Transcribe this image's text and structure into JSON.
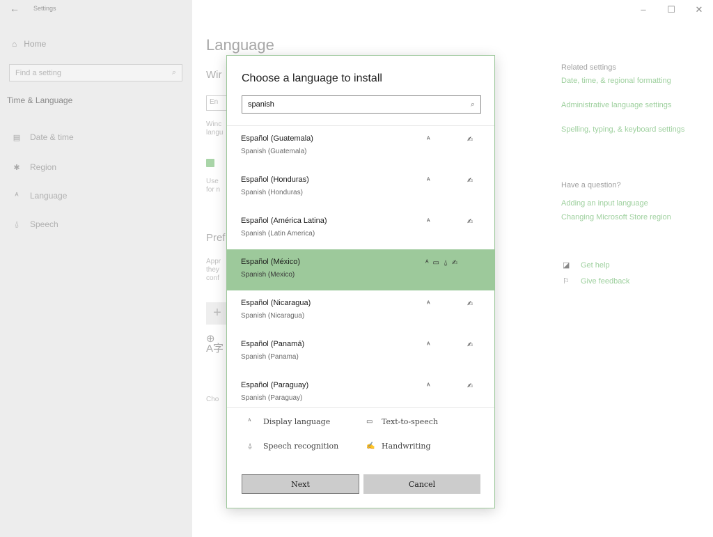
{
  "window": {
    "title": "Settings",
    "controls": [
      "–",
      "☐",
      "✕"
    ]
  },
  "sidebar": {
    "back_icon": "back-arrow-icon",
    "home": "Home",
    "search_placeholder": "Find a setting",
    "section_title": "Time & Language",
    "items": [
      {
        "label": "Date & time",
        "icon": "calendar-clock-icon"
      },
      {
        "label": "Region",
        "icon": "globe-icon"
      },
      {
        "label": "Language",
        "icon": "language-icon"
      },
      {
        "label": "Speech",
        "icon": "microphone-icon"
      }
    ]
  },
  "main": {
    "title": "Language",
    "windows_display_partial": "Wir",
    "field_partial": "En",
    "desc1_partial": [
      "Winc",
      "langu"
    ],
    "desc2_partial": [
      "Use",
      "for n"
    ],
    "preferred_partial": "Pref",
    "app_desc_partial": [
      "Appr",
      "they",
      "conf"
    ],
    "plus": "+",
    "choose_partial": "Cho"
  },
  "related": {
    "header": "Related settings",
    "links": [
      "Date, time, & regional formatting",
      "Administrative language settings",
      "Spelling, typing, & keyboard settings"
    ]
  },
  "question": {
    "header": "Have a question?",
    "links": [
      "Adding an input language",
      "Changing Microsoft Store region"
    ]
  },
  "help": {
    "get_help": "Get help",
    "give_feedback": "Give feedback"
  },
  "dialog": {
    "title": "Choose a language to install",
    "search_value": "spanish",
    "languages": [
      {
        "name": "Español (Guatemala)",
        "english": "Spanish (Guatemala)",
        "selected": false
      },
      {
        "name": "Español (Honduras)",
        "english": "Spanish (Honduras)",
        "selected": false
      },
      {
        "name": "Español (América Latina)",
        "english": "Spanish (Latin America)",
        "selected": false
      },
      {
        "name": "Español (México)",
        "english": "Spanish (Mexico)",
        "selected": true
      },
      {
        "name": "Español (Nicaragua)",
        "english": "Spanish (Nicaragua)",
        "selected": false
      },
      {
        "name": "Español (Panamá)",
        "english": "Spanish (Panama)",
        "selected": false
      },
      {
        "name": "Español (Paraguay)",
        "english": "Spanish (Paraguay)",
        "selected": false
      }
    ],
    "legend": {
      "display_language": "Display language",
      "text_to_speech": "Text-to-speech",
      "speech_recognition": "Speech recognition",
      "handwriting": "Handwriting"
    },
    "buttons": {
      "next": "Next",
      "cancel": "Cancel"
    }
  },
  "colors": {
    "accent_green": "#9dc99b",
    "link_green": "#9ed09e",
    "sidebar_bg": "#ededed"
  }
}
